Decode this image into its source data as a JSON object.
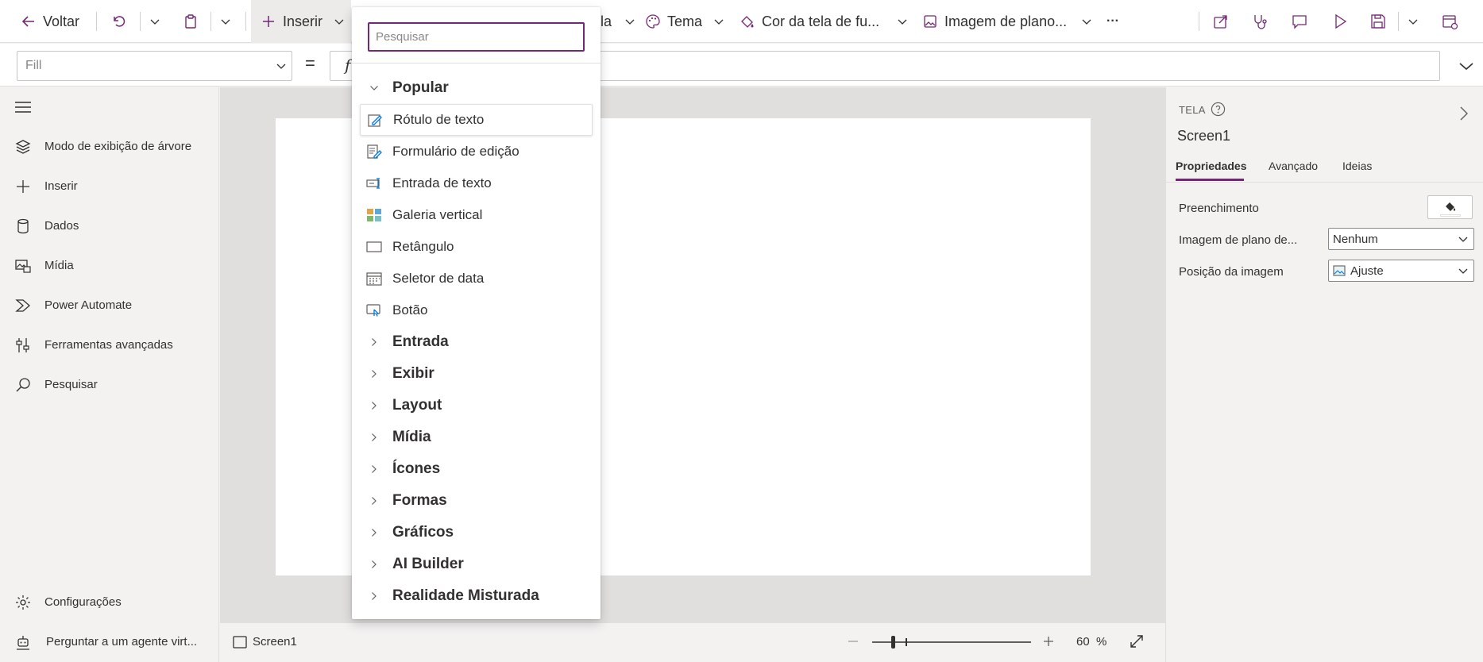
{
  "toolbar": {
    "back_label": "Voltar",
    "insert_label": "Inserir",
    "new_screen_partial": "la",
    "theme_label": "Tema",
    "bg_color_label": "Cor da tela de fu...",
    "bg_image_label": "Imagem de plano...",
    "more_label": "···"
  },
  "formula": {
    "property": "Fill",
    "equals": "=",
    "fx": "f"
  },
  "leftnav": {
    "items": [
      {
        "label": "Modo de exibição de árvore",
        "icon": "layers-icon"
      },
      {
        "label": "Inserir",
        "icon": "plus-icon"
      },
      {
        "label": "Dados",
        "icon": "database-icon"
      },
      {
        "label": "Mídia",
        "icon": "media-icon"
      },
      {
        "label": "Power Automate",
        "icon": "power-automate-icon"
      },
      {
        "label": "Ferramentas avançadas",
        "icon": "tools-icon"
      },
      {
        "label": "Pesquisar",
        "icon": "search-icon"
      }
    ],
    "settings_label": "Configurações",
    "agent_label": "Perguntar a um agente virt..."
  },
  "insert_menu": {
    "search_placeholder": "Pesquisar",
    "popular_label": "Popular",
    "popular_items": [
      {
        "label": "Rótulo de texto",
        "icon": "text-label-icon"
      },
      {
        "label": "Formulário de edição",
        "icon": "edit-form-icon"
      },
      {
        "label": "Entrada de texto",
        "icon": "text-input-icon"
      },
      {
        "label": "Galeria vertical",
        "icon": "gallery-icon"
      },
      {
        "label": "Retângulo",
        "icon": "rectangle-icon"
      },
      {
        "label": "Seletor de data",
        "icon": "date-picker-icon"
      },
      {
        "label": "Botão",
        "icon": "button-icon"
      }
    ],
    "categories": [
      "Entrada",
      "Exibir",
      "Layout",
      "Mídia",
      "Ícones",
      "Formas",
      "Gráficos",
      "AI Builder",
      "Realidade Misturada"
    ]
  },
  "bottombar": {
    "screen_name": "Screen1",
    "zoom_value": "60",
    "zoom_unit": "%",
    "zoom_level": 0.6
  },
  "rightpanel": {
    "section_label": "TELA",
    "screen_name": "Screen1",
    "tabs": [
      "Propriedades",
      "Avançado",
      "Ideias"
    ],
    "fill_label": "Preenchimento",
    "bg_image_label": "Imagem de plano de...",
    "bg_image_value": "Nenhum",
    "image_position_label": "Posição da imagem",
    "image_position_value": "Ajuste"
  },
  "colors": {
    "accent": "#742774",
    "toolbar_bg": "#ffffff",
    "canvas_bg": "#e1dfdd",
    "panel_bg": "#f3f2f1"
  }
}
